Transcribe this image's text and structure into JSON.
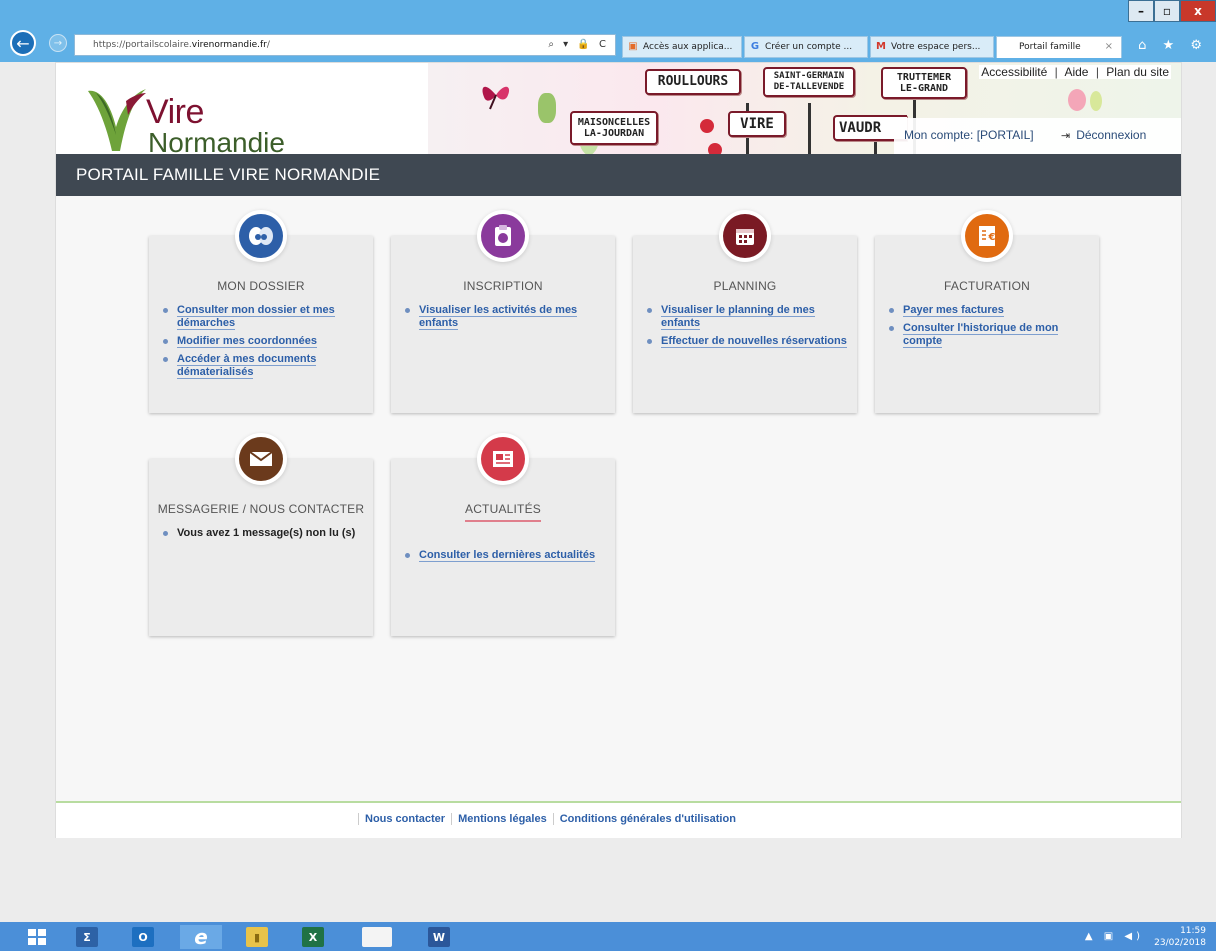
{
  "window": {
    "minimize": "–",
    "restore": "▫",
    "close": "x"
  },
  "browser": {
    "url_prefix": "https://portailscolaire.",
    "url_domain": "virenormandie.fr",
    "url_suffix": "/",
    "address_icons": "⌕ ▾ 🔒 C",
    "tabs": [
      {
        "label": "Accès aux applica...",
        "icon": "▣",
        "icon_color": "#e46c2a"
      },
      {
        "label": "Créer un compte ...",
        "icon": "G",
        "icon_color": "#3d7ee0"
      },
      {
        "label": "Votre espace pers...",
        "icon": "M",
        "icon_color": "#d23a2e"
      },
      {
        "label": "Portail famille",
        "icon": "",
        "icon_color": "#ffffff",
        "close": "×"
      }
    ],
    "right_icons": "⌂ ★ ⚙"
  },
  "header": {
    "logo_vire": "Vire",
    "logo_normandie": "Normandie",
    "signs": {
      "roullours": "ROULLOURS",
      "saint_germain_line1": "SAINT-GERMAIN",
      "saint_germain_line2": "DE-TALLEVENDE",
      "truttemer_line1": "TRUTTEMER",
      "truttemer_line2": "LE-GRAND",
      "maisoncelles_line1": "MAISONCELLES",
      "maisoncelles_line2": "LA-JOURDAN",
      "vire": "VIRE",
      "vaudry": "VAUDR"
    },
    "util_links": {
      "accessibilite": "Accessibilité",
      "aide": "Aide",
      "plan": "Plan du site",
      "separator": "|"
    },
    "account": "Mon compte: [PORTAIL]",
    "logout": "Déconnexion",
    "logout_icon": "⇥"
  },
  "title_bar": "PORTAIL FAMILLE VIRE NORMANDIE",
  "cards": {
    "dossier": {
      "title": "MON DOSSIER",
      "icon": "user-face-icon",
      "color": "#2d5fa8",
      "links": [
        "Consulter mon dossier et mes démarches",
        "Modifier mes coordonnées",
        "Accéder à mes documents dématerialisés"
      ]
    },
    "inscription": {
      "title": "INSCRIPTION",
      "icon": "clipboard-icon",
      "color": "#8a3a9c",
      "links": [
        "Visualiser les activités de mes enfants"
      ]
    },
    "planning": {
      "title": "PLANNING",
      "icon": "calendar-icon",
      "color": "#7a1a24",
      "links": [
        "Visualiser le planning de mes enfants",
        "Effectuer de nouvelles réservations"
      ]
    },
    "facturation": {
      "title": "FACTURATION",
      "icon": "invoice-euro-icon",
      "color": "#e06a10",
      "links": [
        "Payer mes factures",
        "Consulter l'historique de mon compte"
      ]
    },
    "messagerie": {
      "title": "MESSAGERIE / NOUS CONTACTER",
      "icon": "envelope-icon",
      "color": "#6b3a1c",
      "items": [
        "Vous avez 1 message(s) non lu (s)"
      ]
    },
    "actualites": {
      "title": "ACTUALITÉS",
      "icon": "newspaper-icon",
      "color": "#d43a4a",
      "links": [
        "Consulter les dernières actualités"
      ]
    }
  },
  "footer": {
    "links": [
      "Nous contacter",
      "Mentions légales",
      "Conditions générales d'utilisation"
    ]
  },
  "taskbar": {
    "apps": [
      {
        "name": "start",
        "glyph": "⊞",
        "color": "#4b8fd8"
      },
      {
        "name": "powershell",
        "glyph": "Σ",
        "color": "#2d62a6"
      },
      {
        "name": "outlook",
        "glyph": "O",
        "color": "#1d6fc0"
      },
      {
        "name": "internet-explorer",
        "glyph": "e",
        "color": "#3aa6e8"
      },
      {
        "name": "explorer",
        "glyph": "▮",
        "color": "#e8c34a"
      },
      {
        "name": "excel",
        "glyph": "X",
        "color": "#207245"
      },
      {
        "name": "blank-app",
        "glyph": "",
        "color": "#f4f4f4"
      },
      {
        "name": "word",
        "glyph": "W",
        "color": "#2b579a"
      }
    ],
    "tray_icons": "▲ ▣ ◀)",
    "time": "11:59",
    "date": "23/02/2018"
  }
}
